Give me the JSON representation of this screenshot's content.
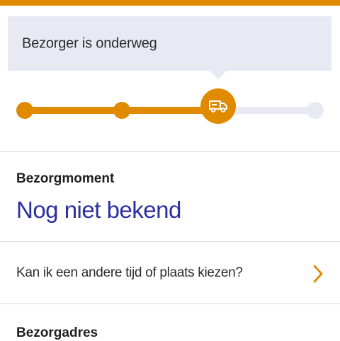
{
  "colors": {
    "accent": "#e08a00",
    "status_bg": "#e9e9f3",
    "link": "#2b2fa0"
  },
  "status": {
    "message": "Bezorger is onderweg"
  },
  "tracker": {
    "steps_total": 4,
    "current_step": 3,
    "current_icon": "delivery-van-icon"
  },
  "bezorgmoment": {
    "label": "Bezorgmoment",
    "value": "Nog niet bekend"
  },
  "change_option": {
    "label": "Kan ik een andere tijd of plaats kiezen?",
    "icon": "chevron-right-icon"
  },
  "bezorgadres": {
    "label": "Bezorgadres"
  }
}
